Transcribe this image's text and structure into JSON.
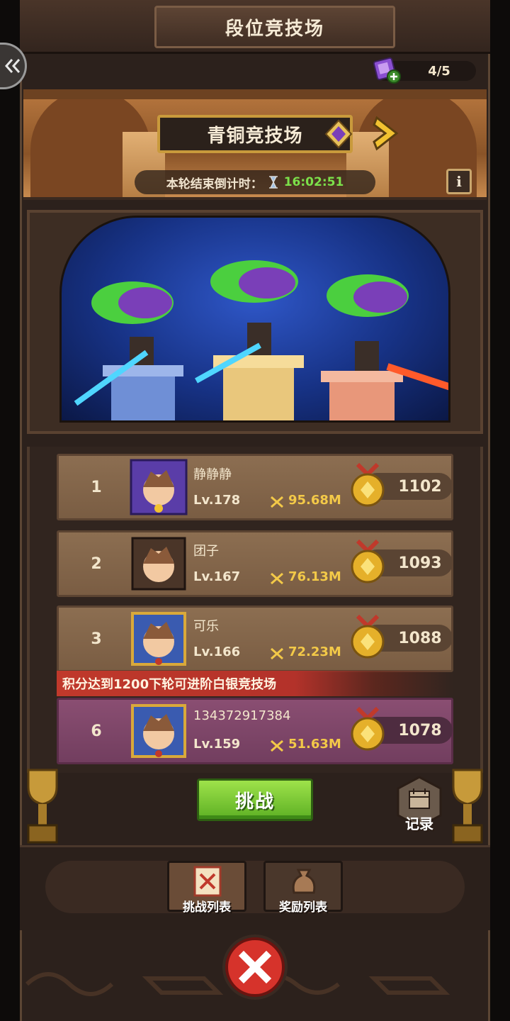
{
  "header": {
    "title": "段位竞技场"
  },
  "tickets": {
    "count": "4/5"
  },
  "arena": {
    "name": "青铜竞技场",
    "countdown_label": "本轮结束倒计时：",
    "countdown_time": "16:02:51",
    "info_label": "i"
  },
  "ranking": [
    {
      "rank": "1",
      "name": "静静静",
      "level": "Lv.178",
      "power": "95.68M",
      "score": "1102"
    },
    {
      "rank": "2",
      "name": "团子",
      "level": "Lv.167",
      "power": "76.13M",
      "score": "1093"
    },
    {
      "rank": "3",
      "name": "可乐",
      "level": "Lv.166",
      "power": "72.23M",
      "score": "1088"
    }
  ],
  "promotion": {
    "text": "积分达到1200下轮可进阶白银竞技场"
  },
  "me": {
    "rank": "6",
    "name": "134372917384",
    "level": "Lv.159",
    "power": "51.63M",
    "score": "1078"
  },
  "actions": {
    "challenge_label": "挑战",
    "record_label": "记录"
  },
  "tabs": [
    {
      "label": "挑战列表",
      "active": true
    },
    {
      "label": "奖励列表",
      "active": false
    }
  ],
  "colors": {
    "accent_green": "#7ce04a",
    "power_gold": "#f3c948",
    "promo_red": "#c0392b",
    "my_row": "#8a4e72"
  },
  "icons": [
    "back-icon",
    "ticket-icon",
    "hourglass-icon",
    "info-icon",
    "next-arrow-icon",
    "medal-icon",
    "power-icon",
    "record-icon",
    "trophy-icon",
    "close-icon"
  ]
}
